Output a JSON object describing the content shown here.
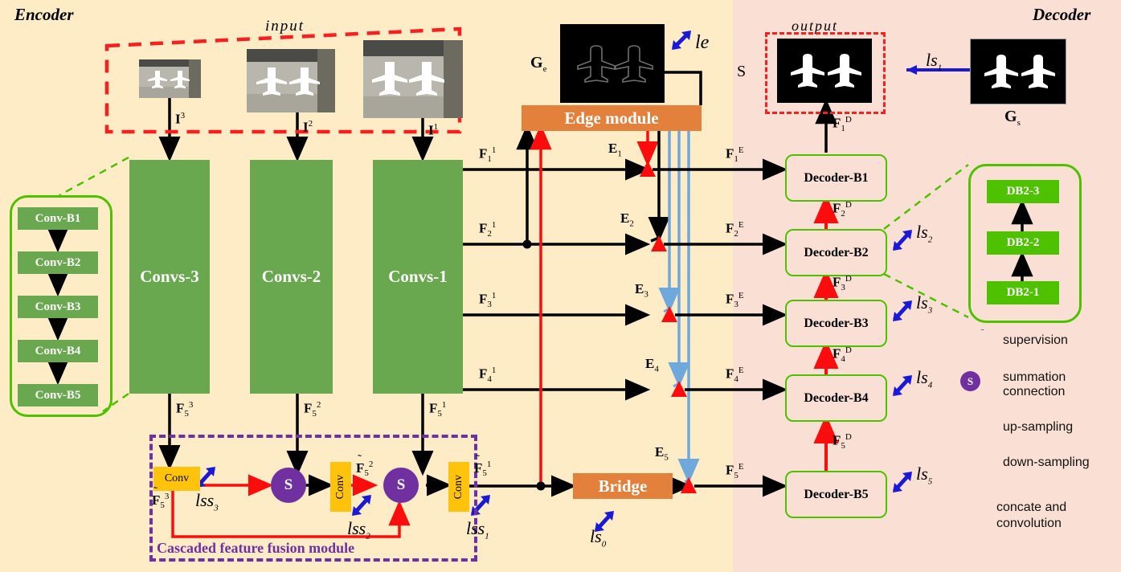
{
  "titles": {
    "encoder": "Encoder",
    "decoder": "Decoder",
    "input": "input",
    "output": "output"
  },
  "encoder": {
    "conv_blocks": [
      "Conv-B1",
      "Conv-B2",
      "Conv-B3",
      "Conv-B4",
      "Conv-B5"
    ],
    "convs": [
      "Convs-3",
      "Convs-2",
      "Convs-1"
    ],
    "input_arrows": [
      "I",
      "I",
      "I"
    ],
    "input_arrow_sup": [
      "3",
      "2",
      "1"
    ],
    "f5_labels": [
      {
        "base": "F",
        "sub": "5",
        "sup": "3"
      },
      {
        "base": "F",
        "sub": "5",
        "sup": "2"
      },
      {
        "base": "F",
        "sub": "5",
        "sup": "1"
      }
    ],
    "f1_labels": [
      {
        "base": "F",
        "sub": "1",
        "sup": "1"
      },
      {
        "base": "F",
        "sub": "2",
        "sup": "1"
      },
      {
        "base": "F",
        "sub": "3",
        "sup": "1"
      },
      {
        "base": "F",
        "sub": "4",
        "sup": "1"
      }
    ]
  },
  "cffm": {
    "title": "Cascaded feature fusion module",
    "conv_label": "Conv",
    "sum_label": "S",
    "tilde_f5": [
      {
        "base": "F",
        "sub": "5",
        "sup": "3"
      },
      {
        "base": "F",
        "sub": "5",
        "sup": "2"
      },
      {
        "base": "F",
        "sub": "5",
        "sup": "1"
      }
    ],
    "losses": [
      {
        "name": "lss",
        "sub": "3"
      },
      {
        "name": "lss",
        "sub": "2"
      },
      {
        "name": "lss",
        "sub": "1"
      }
    ]
  },
  "edge": {
    "module_label": "Edge module",
    "gt_label": {
      "base": "G",
      "sub": "e"
    },
    "loss": {
      "name": "le",
      "sub": ""
    },
    "e_labels": [
      {
        "base": "E",
        "sub": "1"
      },
      {
        "base": "E",
        "sub": "2"
      },
      {
        "base": "E",
        "sub": "3"
      },
      {
        "base": "E",
        "sub": "4"
      },
      {
        "base": "E",
        "sub": "5"
      }
    ]
  },
  "bridge": {
    "label": "Bridge",
    "loss": {
      "name": "ls",
      "sub": "0"
    }
  },
  "decoder": {
    "blocks": [
      "Decoder-B1",
      "Decoder-B2",
      "Decoder-B3",
      "Decoder-B4",
      "Decoder-B5"
    ],
    "fe_labels": [
      {
        "base": "F",
        "sub": "1",
        "sup": "E"
      },
      {
        "base": "F",
        "sub": "2",
        "sup": "E"
      },
      {
        "base": "F",
        "sub": "3",
        "sup": "E"
      },
      {
        "base": "F",
        "sub": "4",
        "sup": "E"
      },
      {
        "base": "F",
        "sub": "5",
        "sup": "E"
      }
    ],
    "fd_labels": [
      {
        "base": "F",
        "sub": "1",
        "sup": "D"
      },
      {
        "base": "F",
        "sub": "2",
        "sup": "D"
      },
      {
        "base": "F",
        "sub": "3",
        "sup": "D"
      },
      {
        "base": "F",
        "sub": "4",
        "sup": "D"
      },
      {
        "base": "F",
        "sub": "5",
        "sup": "D"
      }
    ],
    "losses": [
      {
        "name": "ls",
        "sub": "1"
      },
      {
        "name": "ls",
        "sub": "2"
      },
      {
        "name": "ls",
        "sub": "3"
      },
      {
        "name": "ls",
        "sub": "4"
      },
      {
        "name": "ls",
        "sub": "5"
      }
    ],
    "output_label": "S",
    "gt_label": {
      "base": "G",
      "sub": "s"
    },
    "db_blocks": [
      "DB2-3",
      "DB2-2",
      "DB2-1"
    ]
  },
  "legend": [
    {
      "icon": "supervision-arrow-icon",
      "label": "supervision",
      "color": "#1a1ad6"
    },
    {
      "icon": "summation-circle-icon",
      "label": "summation",
      "color": "#7030a0"
    },
    {
      "icon": "connection-arrow-icon",
      "label": "connection",
      "color": "#000000"
    },
    {
      "icon": "up-sampling-arrow-icon",
      "label": "up-sampling",
      "color": "#fc0d0d"
    },
    {
      "icon": "down-sampling-arrow-icon",
      "label": "down-sampling",
      "color": "#6fa8dc"
    },
    {
      "icon": "concate-triangle-icon",
      "label": "concate and convolution",
      "color": "#fc0d0d"
    }
  ],
  "colors": {
    "encoder_bg": "#fdecc6",
    "decoder_bg": "#fae0d4",
    "green_block": "#6aa84f",
    "bright_green": "#4ec100",
    "orange": "#e2803c",
    "yellow": "#ffc30b",
    "purple": "#7030a0",
    "red": "#fc0d0d",
    "blue": "#1a1ad6",
    "light_blue": "#6fa8dc"
  }
}
